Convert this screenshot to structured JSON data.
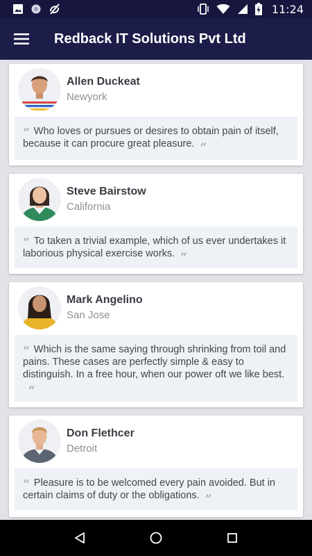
{
  "status_bar": {
    "time": "11:24"
  },
  "app_bar": {
    "title": "Redback IT Solutions Pvt Ltd",
    "icon": "menu-icon"
  },
  "testimonials": [
    {
      "name": "Allen Duckeat",
      "city": "Newyork",
      "quote": "Who loves or pursues or desires to obtain pain of itself, because it can procure great pleasure."
    },
    {
      "name": "Steve Bairstow",
      "city": "California",
      "quote": "To taken a trivial example, which of us ever undertakes it laborious physical exercise works."
    },
    {
      "name": "Mark Angelino",
      "city": "San Jose",
      "quote": "Which is the same saying through shrinking from toil and pains. These cases are perfectly simple & easy to distinguish. In a free hour, when our power oft we like best."
    },
    {
      "name": "Don Flethcer",
      "city": "Detroit",
      "quote": "Pleasure is to be welcomed every pain avoided. But in certain claims of duty or the obligations."
    }
  ],
  "quote_marks": {
    "open": "“",
    "close": "”"
  },
  "colors": {
    "status_bar": "#16163e",
    "app_bar": "#1d1d4a",
    "background": "#e1e3e8",
    "quote_box": "#eef1f5"
  }
}
